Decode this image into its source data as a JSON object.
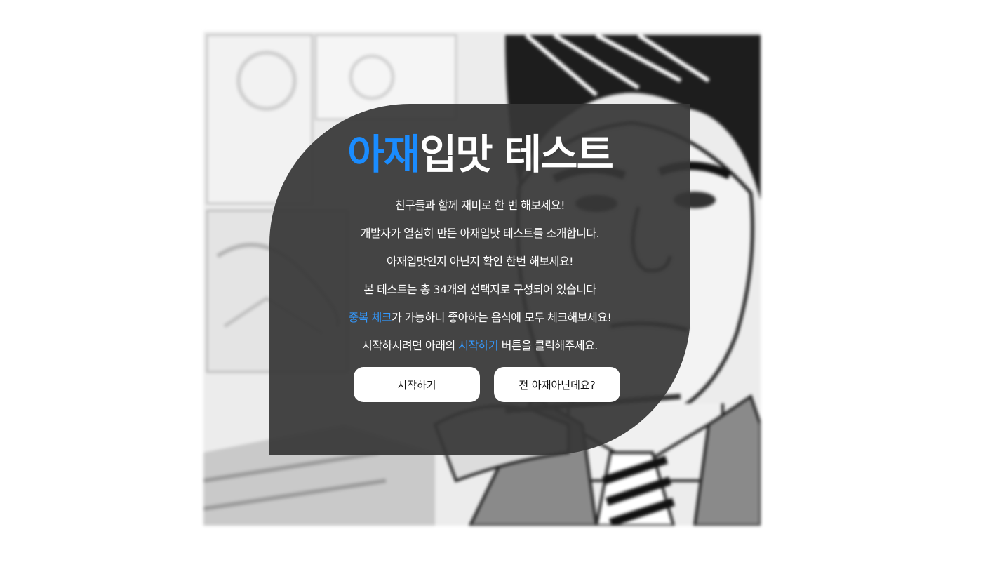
{
  "background": {
    "description_icon": "manga-man-illustration"
  },
  "card": {
    "title_accent": "아재",
    "title_rest": "입맛 테스트",
    "lines": [
      {
        "parts": [
          {
            "text": "친구들과 함께 재미로 한 번 해보세요!",
            "highlight": false
          }
        ]
      },
      {
        "parts": [
          {
            "text": "개발자가 열심히 만든 아재입맛 테스트를 소개합니다.",
            "highlight": false
          }
        ]
      },
      {
        "parts": [
          {
            "text": "아재입맛인지 아닌지 확인 한번 해보세요!",
            "highlight": false
          }
        ]
      },
      {
        "parts": [
          {
            "text": "본 테스트는 총 34개의 선택지로 구성되어 있습니다",
            "highlight": false
          }
        ]
      },
      {
        "parts": [
          {
            "text": "중복 체크",
            "highlight": true
          },
          {
            "text": "가 가능하니 좋아하는 음식에 모두 체크해보세요!",
            "highlight": false
          }
        ]
      },
      {
        "parts": [
          {
            "text": "시작하시려면 아래의 ",
            "highlight": false
          },
          {
            "text": "시작하기",
            "highlight": true
          },
          {
            "text": " 버튼을 클릭해주세요.",
            "highlight": false
          }
        ]
      }
    ],
    "start_button": "시작하기",
    "not_ajae_button": "전 아재아닌데요?"
  },
  "colors": {
    "accent": "#1a8cff",
    "highlight": "#3399ff",
    "card_bg": "#373737",
    "button_bg": "#ffffff"
  }
}
